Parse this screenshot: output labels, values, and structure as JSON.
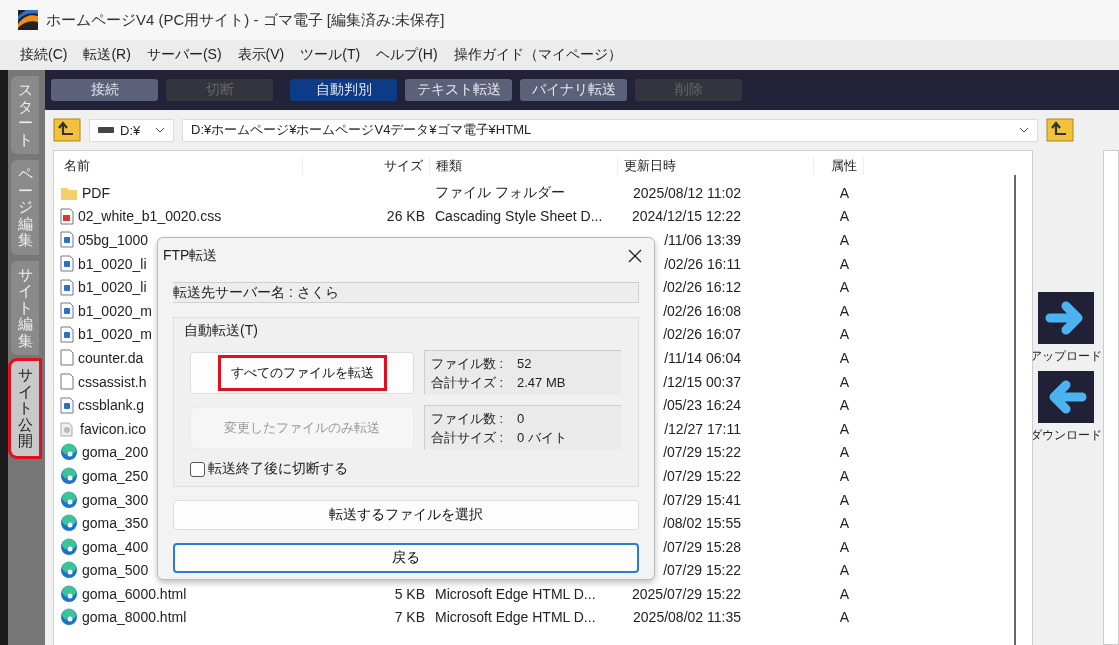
{
  "window": {
    "title": "ホームページV4 (PC用サイト) - ゴマ電子 [編集済み:未保存]"
  },
  "menu": [
    "接続(C)",
    "転送(R)",
    "サーバー(S)",
    "表示(V)",
    "ツール(T)",
    "ヘルプ(H)",
    "操作ガイド（マイページ）"
  ],
  "side_tabs": [
    {
      "label": "スタート",
      "selected": false,
      "annotated": false
    },
    {
      "label": "ページ編集",
      "selected": false,
      "annotated": false
    },
    {
      "label": "サイト編集",
      "selected": false,
      "annotated": false
    },
    {
      "label": "サイト公開",
      "selected": true,
      "annotated": true
    }
  ],
  "toolbar": [
    {
      "label": "接続",
      "selected": false,
      "disabled": false
    },
    {
      "label": "切断",
      "selected": false,
      "disabled": true
    },
    {
      "label": "自動判別",
      "selected": true,
      "disabled": false
    },
    {
      "label": "テキスト転送",
      "selected": false,
      "disabled": false
    },
    {
      "label": "バイナリ転送",
      "selected": false,
      "disabled": false
    },
    {
      "label": "削除",
      "selected": false,
      "disabled": true
    }
  ],
  "path_bar": {
    "drive": "D:¥",
    "path": "D:¥ホームページ¥ホームページV4データ¥ゴマ電子¥HTML"
  },
  "file_list": {
    "columns": [
      "名前",
      "サイズ",
      "種類",
      "更新日時",
      "属性"
    ],
    "rows": [
      {
        "kind": "folder",
        "name": "PDF",
        "type": "ファイル フォルダー",
        "modified": "2025/08/12 11:02",
        "attr": "A"
      },
      {
        "kind": "css",
        "name": "02_white_b1_0020.css",
        "size": "26 KB",
        "type": "Cascading Style Sheet D...",
        "modified": "2024/12/15 12:22",
        "attr": "A"
      },
      {
        "kind": "image",
        "name": "05bg_1000",
        "modified": "/11/06 13:39",
        "attr": "A"
      },
      {
        "kind": "image",
        "name": "b1_0020_li",
        "modified": "/02/26 16:11",
        "attr": "A"
      },
      {
        "kind": "image",
        "name": "b1_0020_li",
        "modified": "/02/26 16:12",
        "attr": "A"
      },
      {
        "kind": "image",
        "name": "b1_0020_m",
        "modified": "/02/26 16:08",
        "attr": "A"
      },
      {
        "kind": "image",
        "name": "b1_0020_m",
        "modified": "/02/26 16:07",
        "attr": "A"
      },
      {
        "kind": "text",
        "name": "counter.da",
        "modified": "/11/14 06:04",
        "attr": "A"
      },
      {
        "kind": "text",
        "name": "cssassist.h",
        "modified": "/12/15 00:37",
        "attr": "A"
      },
      {
        "kind": "image",
        "name": "cssblank.g",
        "modified": "/05/23 16:24",
        "attr": "A"
      },
      {
        "kind": "ico",
        "name": "favicon.ico",
        "modified": "/12/27 17:11",
        "attr": "A"
      },
      {
        "kind": "edge",
        "name": "goma_200",
        "modified": "/07/29 15:22",
        "attr": "A"
      },
      {
        "kind": "edge",
        "name": "goma_250",
        "modified": "/07/29 15:22",
        "attr": "A"
      },
      {
        "kind": "edge",
        "name": "goma_300",
        "modified": "/07/29 15:41",
        "attr": "A"
      },
      {
        "kind": "edge",
        "name": "goma_350",
        "modified": "/08/02 15:55",
        "attr": "A"
      },
      {
        "kind": "edge",
        "name": "goma_400",
        "modified": "/07/29 15:28",
        "attr": "A"
      },
      {
        "kind": "edge",
        "name": "goma_500",
        "modified": "/07/29 15:22",
        "attr": "A"
      },
      {
        "kind": "edge",
        "name": "goma_6000.html",
        "size": "5 KB",
        "type": "Microsoft Edge HTML D...",
        "modified": "2025/07/29 15:22",
        "attr": "A"
      },
      {
        "kind": "edge",
        "name": "goma_8000.html",
        "size": "7 KB",
        "type": "Microsoft Edge HTML D...",
        "modified": "2025/08/02 11:35",
        "attr": "A"
      }
    ]
  },
  "transfer_buttons": [
    {
      "kind": "upload",
      "label": "アップロード"
    },
    {
      "kind": "download",
      "label": "ダウンロード"
    }
  ],
  "dialog": {
    "title": "FTP転送",
    "server": "転送先サーバー名 : さくら",
    "group_label": "自動転送(T)",
    "actions": [
      {
        "label": "すべてのファイルを転送",
        "disabled": false,
        "annotated": true,
        "info": [
          {
            "label": "ファイル数 :",
            "value": "52"
          },
          {
            "label": "合計サイズ :",
            "value": "2.47 MB"
          }
        ]
      },
      {
        "label": "変更したファイルのみ転送",
        "disabled": true,
        "annotated": false,
        "info": [
          {
            "label": "ファイル数 :",
            "value": "0"
          },
          {
            "label": "合計サイズ :",
            "value": "0 バイト"
          }
        ]
      }
    ],
    "checkbox": {
      "label": "転送終了後に切断する",
      "checked": false
    },
    "buttons": [
      {
        "label": "転送するファイルを選択",
        "focused": false
      },
      {
        "label": "戻る",
        "focused": true
      }
    ]
  }
}
